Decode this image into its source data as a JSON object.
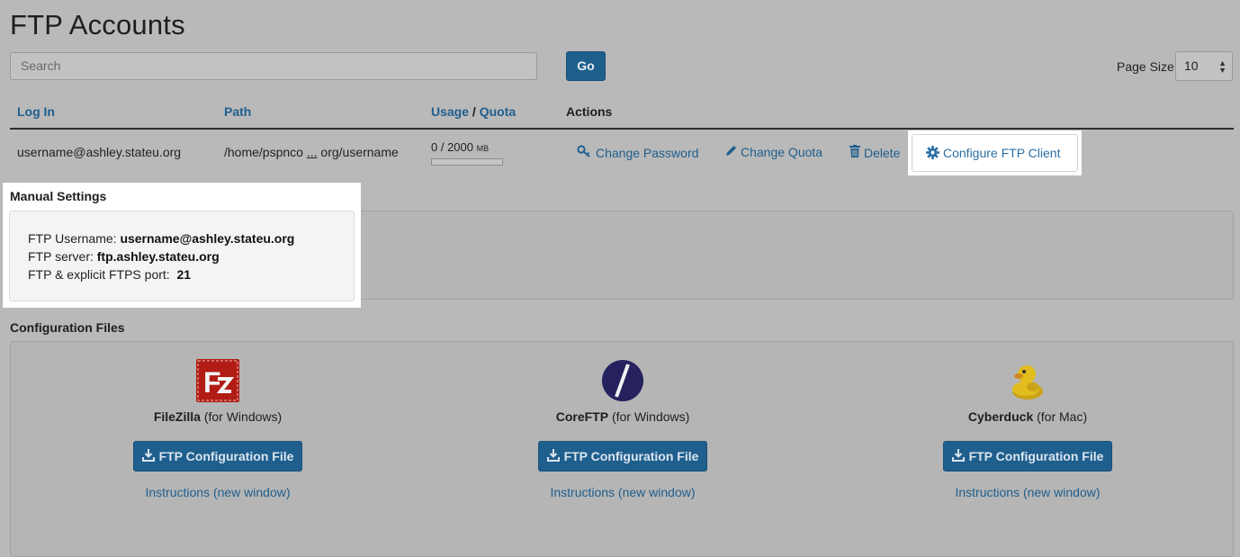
{
  "page": {
    "title": "FTP Accounts"
  },
  "search": {
    "placeholder": "Search",
    "go_label": "Go"
  },
  "pagination": {
    "label": "Page Size",
    "value": "10"
  },
  "table": {
    "headers": {
      "login": "Log In",
      "path": "Path",
      "usage": "Usage",
      "separator": "/",
      "quota": "Quota",
      "actions": "Actions"
    },
    "row": {
      "login": "username@ashley.stateu.org",
      "path_start": "/home/pspnco",
      "path_ellipsis": "...",
      "path_end": "org/username",
      "usage_value": "0 / 2000",
      "usage_unit": "MB",
      "usage_fraction": 0,
      "actions": {
        "change_password": "Change Password",
        "change_quota": "Change Quota",
        "delete": "Delete",
        "configure": "Configure FTP Client"
      }
    }
  },
  "manual_settings": {
    "title": "Manual Settings",
    "username_label": "FTP Username:",
    "username_value": "username@ashley.stateu.org",
    "server_label": "FTP server:",
    "server_value": "ftp.ashley.stateu.org",
    "port_label": "FTP & explicit FTPS port:",
    "port_value": "21"
  },
  "config_files": {
    "title": "Configuration Files",
    "clients": [
      {
        "name": "FileZilla",
        "platform": "(for Windows)",
        "button": "FTP Configuration File",
        "instructions": "Instructions (new window)",
        "icon": "filezilla-logo"
      },
      {
        "name": "CoreFTP",
        "platform": "(for Windows)",
        "button": "FTP Configuration File",
        "instructions": "Instructions (new window)",
        "icon": "coreftp-logo"
      },
      {
        "name": "Cyberduck",
        "platform": "(for Mac)",
        "button": "FTP Configuration File",
        "instructions": "Instructions (new window)",
        "icon": "cyberduck-logo"
      }
    ]
  },
  "colors": {
    "background": "#b9b9b9",
    "link": "#1f5f8e",
    "button": "#1f5f8e",
    "highlight": "#ffffff"
  }
}
